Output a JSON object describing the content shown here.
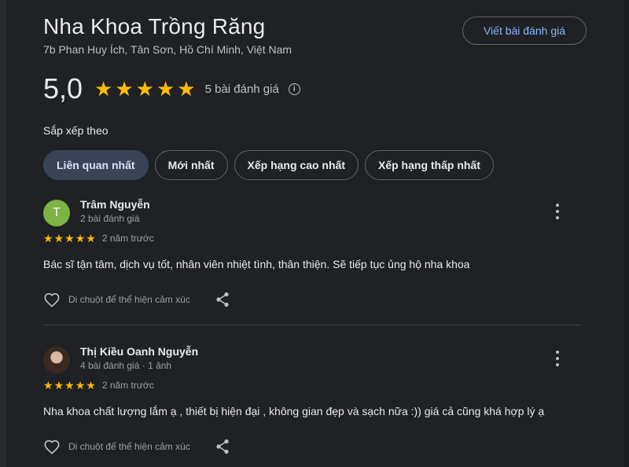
{
  "business": {
    "name": "Nha Khoa Trồng Răng",
    "address": "7b Phan Huy Ích, Tân Sơn, Hồ Chí Minh, Việt Nam",
    "rating": "5,0",
    "stars": 5,
    "review_count": "5 bài đánh giá"
  },
  "actions": {
    "write_review": "Viết bài đánh giá"
  },
  "sort": {
    "label": "Sắp xếp theo",
    "options": [
      "Liên quan nhất",
      "Mới nhất",
      "Xếp hạng cao nhất",
      "Xếp hạng thấp nhất"
    ],
    "selected": "Liên quan nhất"
  },
  "reviews": [
    {
      "author": "Trâm Nguyễn",
      "avatar_letter": "T",
      "meta": "2 bài đánh giá",
      "stars": 5,
      "time": "2 năm trước",
      "text": "Bác sĩ tận tâm, dịch vụ tốt, nhân viên nhiệt tình, thân thiện. Sẽ tiếp tục ủng hộ nha khoa",
      "like_label": "Di chuột để thể hiện cảm xúc"
    },
    {
      "author": "Thị Kiều Oanh Nguyễn",
      "avatar_letter": "",
      "meta": "4 bài đánh giá · 1 ảnh",
      "stars": 5,
      "time": "2 năm trước",
      "text": "Nha khoa chất lượng lắm ạ , thiết bị hiện đại , không gian đẹp và sạch nữa :)) giá cả cũng khá hợp lý ạ",
      "like_label": "Di chuột để thể hiện cảm xúc"
    }
  ],
  "colors": {
    "background": "#202124",
    "star": "#fbbc04",
    "accent_text": "#8ab4f8",
    "active_chip": "#394457",
    "avatar_green": "#7cb342"
  },
  "icons": [
    "star-icon",
    "info-icon",
    "more-vert-icon",
    "heart-icon",
    "share-icon"
  ]
}
